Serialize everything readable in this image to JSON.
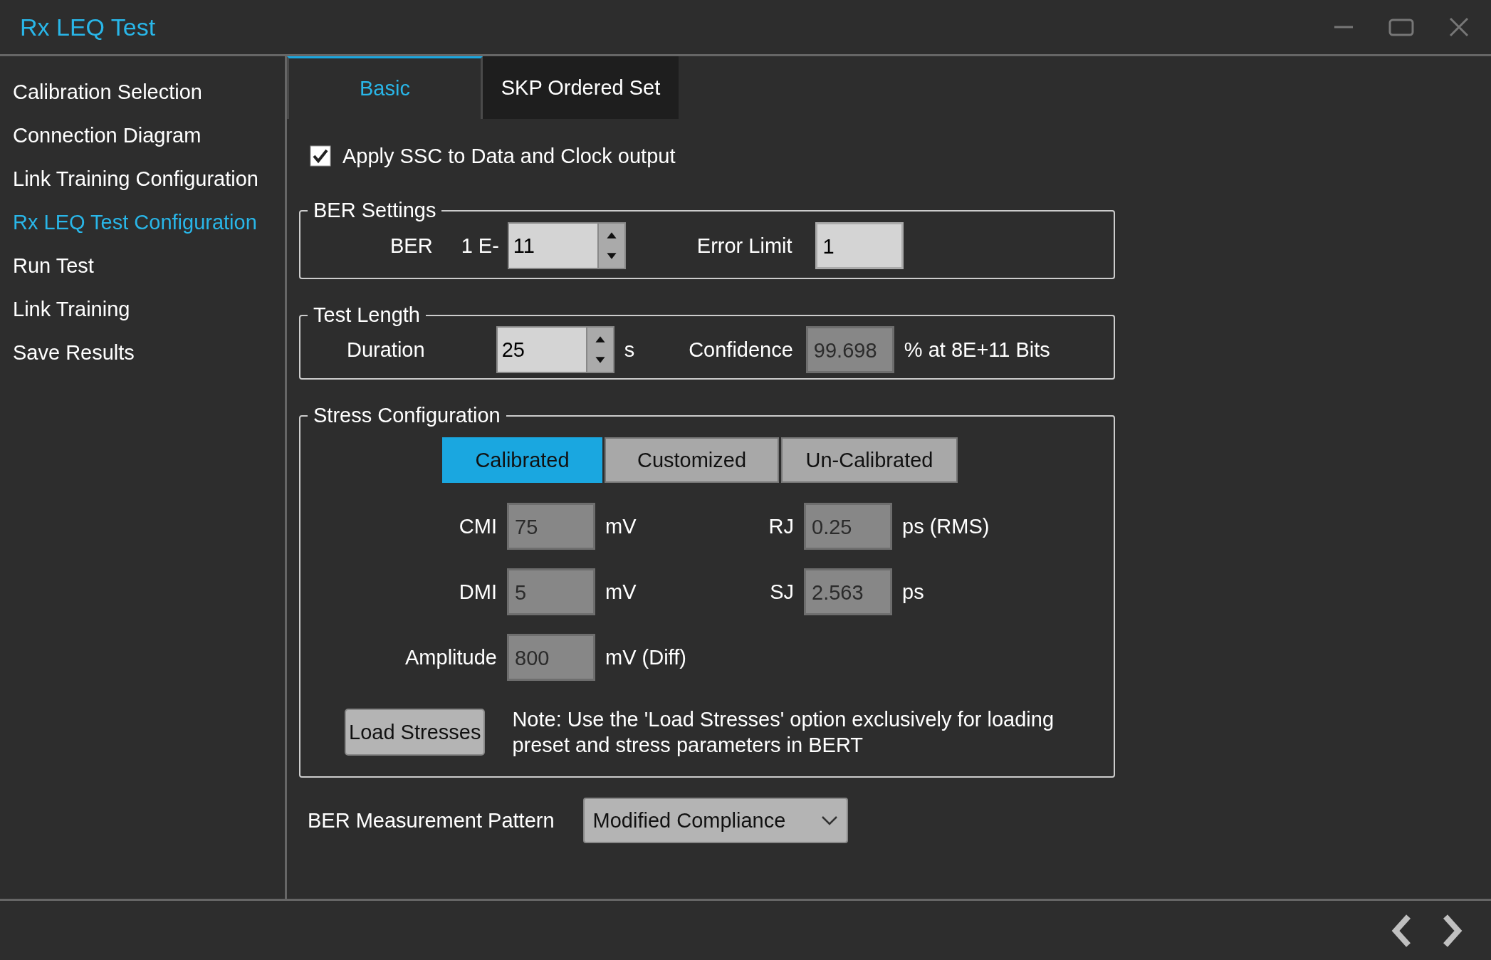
{
  "window": {
    "title": "Rx LEQ Test"
  },
  "sidebar": {
    "items": [
      {
        "label": "Calibration Selection",
        "selected": false
      },
      {
        "label": "Connection Diagram",
        "selected": false
      },
      {
        "label": "Link Training Configuration",
        "selected": false
      },
      {
        "label": "Rx LEQ Test Configuration",
        "selected": true
      },
      {
        "label": "Run Test",
        "selected": false
      },
      {
        "label": "Link Training",
        "selected": false
      },
      {
        "label": "Save Results",
        "selected": false
      }
    ]
  },
  "tabs": [
    {
      "label": "Basic",
      "selected": true
    },
    {
      "label": "SKP Ordered Set",
      "selected": false
    }
  ],
  "ssc": {
    "label": "Apply SSC to Data and Clock output",
    "checked": true
  },
  "ber_settings": {
    "title": "BER Settings",
    "ber_label": "BER",
    "prefix": "1 E-",
    "ber_value": "11",
    "error_limit_label": "Error Limit",
    "error_limit_value": "1"
  },
  "test_length": {
    "title": "Test Length",
    "duration_label": "Duration",
    "duration_value": "25",
    "duration_unit": "s",
    "confidence_label": "Confidence",
    "confidence_value": "99.698",
    "confidence_unit": "% at 8E+11 Bits"
  },
  "stress": {
    "title": "Stress Configuration",
    "modes": [
      {
        "label": "Calibrated",
        "selected": true
      },
      {
        "label": "Customized",
        "selected": false
      },
      {
        "label": "Un-Calibrated",
        "selected": false
      }
    ],
    "fields": [
      {
        "label": "CMI",
        "value": "75",
        "unit": "mV"
      },
      {
        "label": "RJ",
        "value": "0.25",
        "unit": "ps (RMS)"
      },
      {
        "label": "DMI",
        "value": "5",
        "unit": "mV"
      },
      {
        "label": "SJ",
        "value": "2.563",
        "unit": "ps"
      },
      {
        "label": "Amplitude",
        "value": "800",
        "unit": "mV (Diff)"
      }
    ],
    "load_button": "Load Stresses",
    "note": "Note: Use the 'Load Stresses' option exclusively for loading preset and stress parameters in BERT"
  },
  "pattern": {
    "label": "BER Measurement Pattern",
    "value": "Modified Compliance"
  }
}
